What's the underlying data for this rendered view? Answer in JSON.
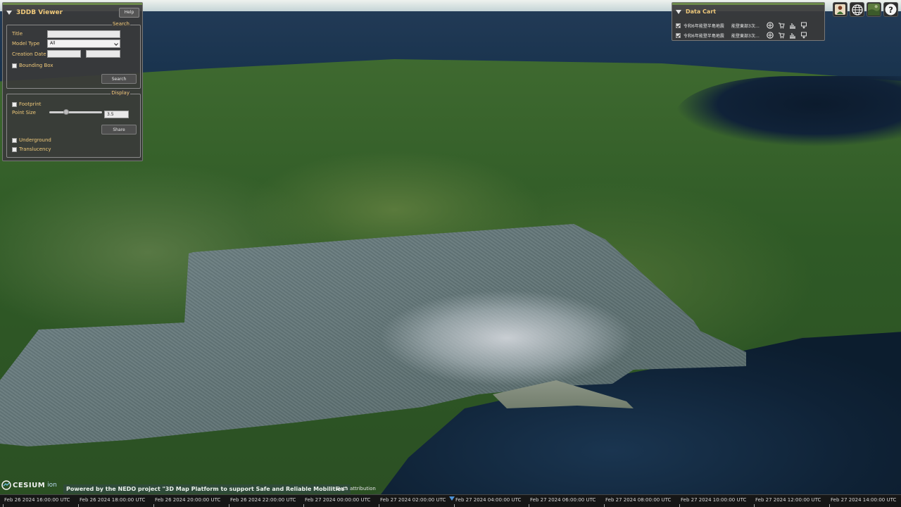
{
  "viewer": {
    "title": "3DDB Viewer",
    "help_label": "Help",
    "search": {
      "legend": "Search",
      "title_label": "Title",
      "title_value": "",
      "model_type_label": "Model Type",
      "model_type_value": "All",
      "creation_date_label": "Creation Date",
      "date_from": "",
      "date_to": "",
      "bounding_box_label": "Bounding Box",
      "search_button": "Search"
    },
    "display": {
      "legend": "Display",
      "footprint_label": "Footprint",
      "point_size_label": "Point Size",
      "point_size_value": "3.5",
      "share_button": "Share",
      "underground_label": "Underground",
      "translucency_label": "Translucency"
    }
  },
  "cart": {
    "title": "Data Cart",
    "items": [
      {
        "name": "令和6年能登半島地震",
        "sub": "能登東部3次…"
      },
      {
        "name": "令和6年能登半島地震",
        "sub": "能登東部3次…"
      }
    ]
  },
  "footer": {
    "cesium_text": "CESIUM",
    "cesium_ion": "ion",
    "nedo_text": "Powered by the NEDO project \"3D Map Platform to support Safe and Reliable Mobilities\"",
    "attribution": "Data attribution"
  },
  "timeline": {
    "labels": [
      "Feb 26 2024 16:00:00 UTC",
      "Feb 26 2024 18:00:00 UTC",
      "Feb 26 2024 20:00:00 UTC",
      "Feb 26 2024 22:00:00 UTC",
      "Feb 27 2024 00:00:00 UTC",
      "Feb 27 2024 02:00:00 UTC",
      "Feb 27 2024 04:00:00 UTC",
      "Feb 27 2024 06:00:00 UTC",
      "Feb 27 2024 08:00:00 UTC",
      "Feb 27 2024 10:00:00 UTC",
      "Feb 27 2024 12:00:00 UTC",
      "Feb 27 2024 14:00:00 UTC"
    ]
  },
  "colors": {
    "accent": "#f0c97a",
    "panel": "#3a3a3a",
    "header_bar": "#6c8a4a",
    "nedo_bg": "#2f4a39"
  },
  "icons": {
    "cart_actions": [
      "flyto-icon",
      "cart-remove-icon",
      "chart-icon",
      "download-icon"
    ],
    "toolbar": [
      "person-icon",
      "globe-icon",
      "imagery-layer-icon",
      "help-icon"
    ]
  }
}
